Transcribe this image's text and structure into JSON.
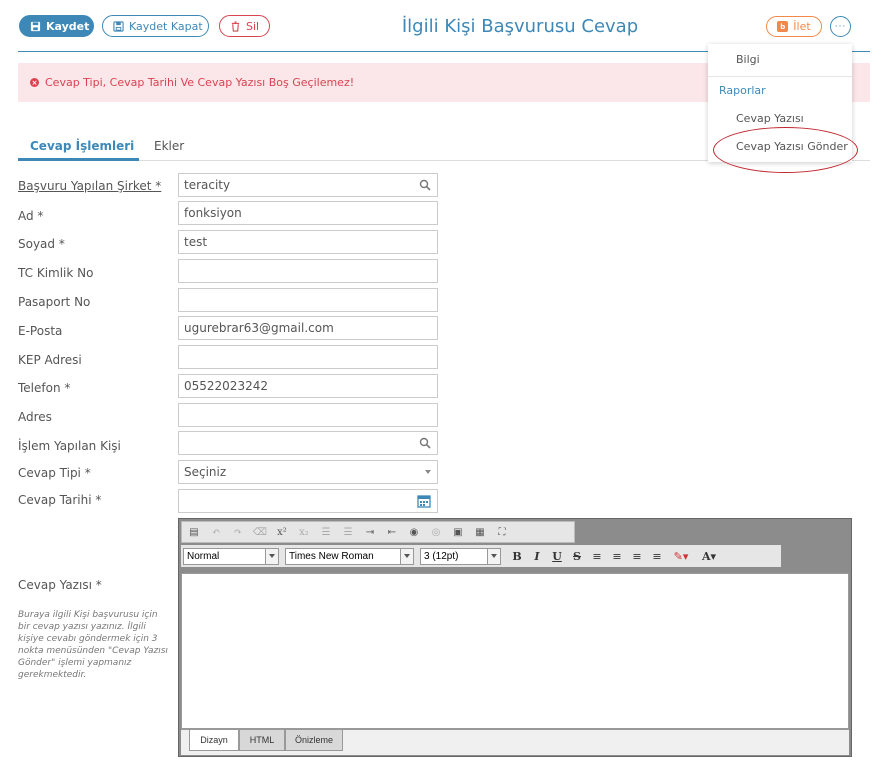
{
  "toolbar": {
    "save_label": "Kaydet",
    "save_close_label": "Kaydet Kapat",
    "delete_label": "Sil",
    "forward_label": "İlet",
    "more_label": "···"
  },
  "page": {
    "title": "İlgili Kişi Başvurusu Cevap"
  },
  "alert": {
    "message": "Cevap Tipi, Cevap Tarihi Ve Cevap Yazısı Boş Geçilemez!"
  },
  "tabs": [
    {
      "label": "Cevap İşlemleri",
      "active": true
    },
    {
      "label": "Ekler",
      "active": false
    }
  ],
  "form": {
    "company": {
      "label": "Başvuru Yapılan Şirket *",
      "value": "teracity"
    },
    "first_name": {
      "label": "Ad *",
      "value": "fonksiyon"
    },
    "last_name": {
      "label": "Soyad *",
      "value": "test"
    },
    "tc": {
      "label": "TC Kimlik No",
      "value": ""
    },
    "passport": {
      "label": "Pasaport No",
      "value": ""
    },
    "email": {
      "label": "E-Posta",
      "value": "ugurebrar63@gmail.com"
    },
    "kep": {
      "label": "KEP Adresi",
      "value": ""
    },
    "phone": {
      "label": "Telefon *",
      "value": "05522023242"
    },
    "address": {
      "label": "Adres",
      "value": ""
    },
    "operator": {
      "label": "İşlem Yapılan Kişi",
      "value": ""
    },
    "reply_type": {
      "label": "Cevap Tipi *",
      "value": "Seçiniz"
    },
    "reply_date": {
      "label": "Cevap Tarihi *",
      "value": ""
    },
    "reply_text": {
      "label": "Cevap Yazısı *",
      "help": "Buraya ilgili Kişi başvurusu için bir cevap yazısı yazınız. İlgili kişiye cevabı göndermek için 3 nokta menüsünden \"Cevap Yazısı Gönder\" işlemi yapmanız gerekmektedir."
    }
  },
  "editor": {
    "format": "Normal",
    "font": "Times New Roman",
    "size": "3 (12pt)",
    "bold": "B",
    "italic": "I",
    "underline": "U",
    "strike": "S",
    "font_color": "A",
    "tabs": [
      "Dizayn",
      "HTML",
      "Önizleme"
    ]
  },
  "menu": {
    "info": "Bilgi",
    "reports_section": "Raporlar",
    "reply_text": "Cevap Yazısı",
    "send_reply": "Cevap Yazısı Gönder"
  },
  "colors": {
    "primary": "#3d88b7",
    "danger": "#d9434f",
    "accent": "#f0894a",
    "alert_bg": "#fbe6e9"
  }
}
